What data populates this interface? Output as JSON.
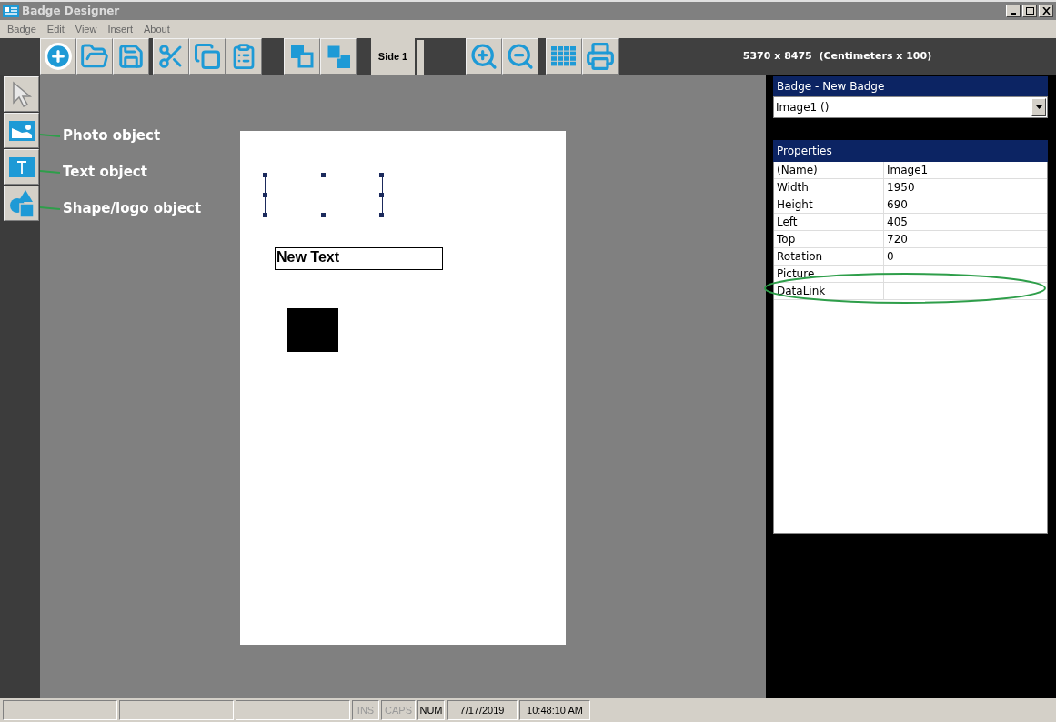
{
  "window": {
    "title": "Badge Designer"
  },
  "menu": [
    "Badge",
    "Edit",
    "View",
    "Insert",
    "About"
  ],
  "toolbar": {
    "side_tab": {
      "label": "Side 1",
      "selected": true
    },
    "dimensions": "5370 x 8475  (Centimeters x 100)"
  },
  "tools": [
    {
      "kind": "pointer",
      "selected": false
    },
    {
      "kind": "photo",
      "selected": false,
      "annotation": "Photo object"
    },
    {
      "kind": "text",
      "selected": false,
      "annotation": "Text object"
    },
    {
      "kind": "shape",
      "selected": false,
      "annotation": "Shape/logo object"
    }
  ],
  "badge_objects": [
    {
      "kind": "image",
      "selected": true
    },
    {
      "kind": "text",
      "text": "New Text"
    },
    {
      "kind": "shape"
    }
  ],
  "badge_panel": {
    "title": "Badge - New Badge",
    "object_select": "Image1 ()"
  },
  "properties": {
    "title": "Properties",
    "rows": [
      {
        "name": "(Name)",
        "value": "Image1"
      },
      {
        "name": "Width",
        "value": "1950"
      },
      {
        "name": "Height",
        "value": "690"
      },
      {
        "name": "Left",
        "value": "405"
      },
      {
        "name": "Top",
        "value": "720"
      },
      {
        "name": "Rotation",
        "value": "0"
      },
      {
        "name": "Picture"
      },
      {
        "name": "DataLink",
        "highlighted": true
      }
    ]
  },
  "status_bar": [
    {
      "kind": "blank"
    },
    {
      "kind": "blank"
    },
    {
      "kind": "blank"
    },
    {
      "kind": "key",
      "text": "INS",
      "disabled": true
    },
    {
      "kind": "key",
      "text": "CAPS",
      "disabled": true
    },
    {
      "kind": "key",
      "text": "NUM",
      "disabled": false
    },
    {
      "kind": "date",
      "text": "7/17/2019"
    },
    {
      "kind": "time",
      "text": "10:48:10 AM"
    }
  ]
}
